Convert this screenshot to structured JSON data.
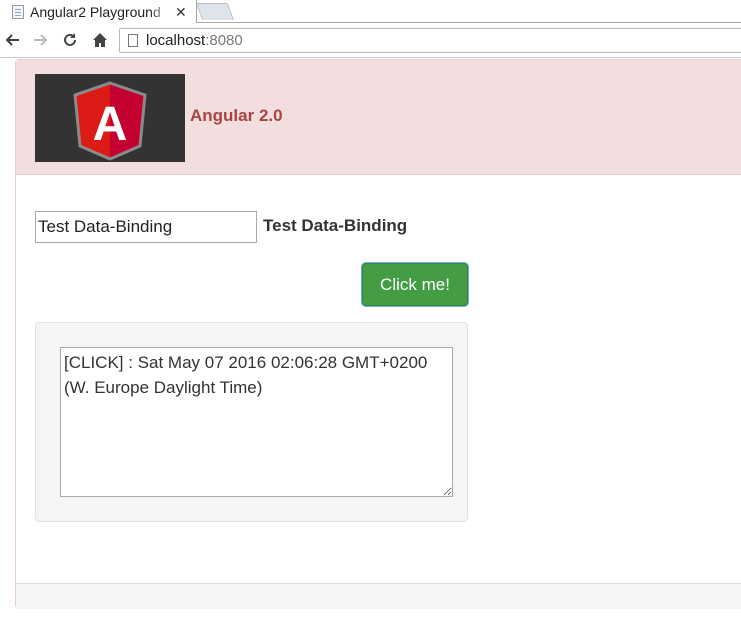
{
  "browser": {
    "tab_title": "Angular2 Playground",
    "tab_close": "✕",
    "url_host": "localhost",
    "url_port": ":8080",
    "icons": {
      "back": "back-arrow-icon",
      "forward": "forward-arrow-icon",
      "reload": "reload-icon",
      "home": "home-icon",
      "page": "page-icon"
    }
  },
  "header": {
    "logo_letter": "A",
    "title": "Angular 2.0",
    "colors": {
      "heading_bg": "#f2dede",
      "title_color": "#a94442",
      "logo_bg": "#333333",
      "shield_red": "#dd1b16",
      "shield_dark": "#c3002f"
    }
  },
  "form": {
    "input_value": "Test Data-Binding",
    "bound_text": "Test Data-Binding",
    "button_label": "Click me!",
    "button_color": "#449d44"
  },
  "log": {
    "text": "[CLICK] : Sat May 07 2016 02:06:28 GMT+0200 (W. Europe Daylight Time)"
  }
}
